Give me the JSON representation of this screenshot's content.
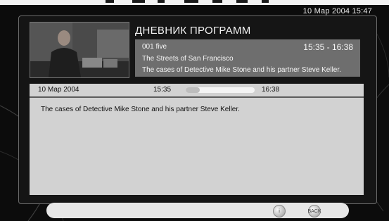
{
  "header": {
    "datetime": "10 Мар 2004  15:47",
    "title": "ДНЕВНИК ПРОГРАММ"
  },
  "current": {
    "channel": "001 five",
    "time_range": "15:35 - 16:38",
    "programme": "The Streets of San Francisco",
    "synopsis": "The cases of Detective Mike Stone and his partner Steve Keller."
  },
  "details": {
    "date": "10 Мар 2004",
    "start": "15:35",
    "end": "16:38",
    "progress": 0.2,
    "description": "The cases of Detective Mike Stone and his partner Steve Keller."
  },
  "buttons": {
    "info": {
      "icon": "info-icon",
      "label": "i"
    },
    "back": {
      "icon": "back-icon",
      "label": "BACK"
    }
  }
}
